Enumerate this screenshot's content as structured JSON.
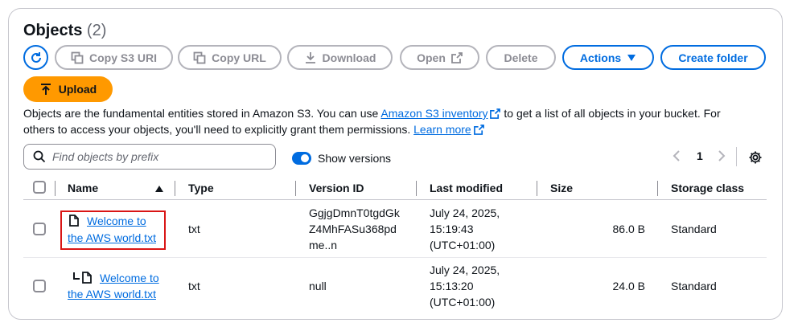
{
  "header": {
    "title": "Objects",
    "count": "(2)"
  },
  "toolbar": {
    "copy_s3_uri": "Copy S3 URI",
    "copy_url": "Copy URL",
    "download": "Download",
    "open": "Open",
    "delete": "Delete",
    "actions": "Actions",
    "create_folder": "Create folder",
    "upload": "Upload"
  },
  "description": {
    "part1": "Objects are the fundamental entities stored in Amazon S3. You can use ",
    "link1": "Amazon S3 inventory",
    "part2": " to get a list of all objects in your bucket. For others to access your objects, you'll need to explicitly grant them permissions. ",
    "link2": "Learn more"
  },
  "search": {
    "placeholder": "Find objects by prefix"
  },
  "versions_toggle": {
    "label": "Show versions",
    "on": true
  },
  "pagination": {
    "prev": "‹",
    "page": "1",
    "next": "›"
  },
  "table": {
    "headers": {
      "name": "Name",
      "type": "Type",
      "version_id": "Version ID",
      "last_modified": "Last modified",
      "size": "Size",
      "storage_class": "Storage class"
    },
    "rows": [
      {
        "name_line1": "Welcome to",
        "name_line2": "the AWS world.txt",
        "type": "txt",
        "version_line1": "GgjgDmnT0tgdGk",
        "version_line2": "Z4MhFASu368pd",
        "version_line3": "me..n",
        "modified_line1": "July 24, 2025,",
        "modified_line2": "15:19:43",
        "modified_line3": "(UTC+01:00)",
        "size": "86.0 B",
        "storage_class": "Standard"
      },
      {
        "name_line1": "Welcome to",
        "name_line2": "the AWS world.txt",
        "type": "txt",
        "version": "null",
        "modified_line1": "July 24, 2025,",
        "modified_line2": "15:13:20",
        "modified_line3": "(UTC+01:00)",
        "size": "24.0 B",
        "storage_class": "Standard"
      }
    ]
  },
  "colors": {
    "accent": "#006ce0",
    "upload": "#ff9900",
    "highlight": "#d91515"
  }
}
